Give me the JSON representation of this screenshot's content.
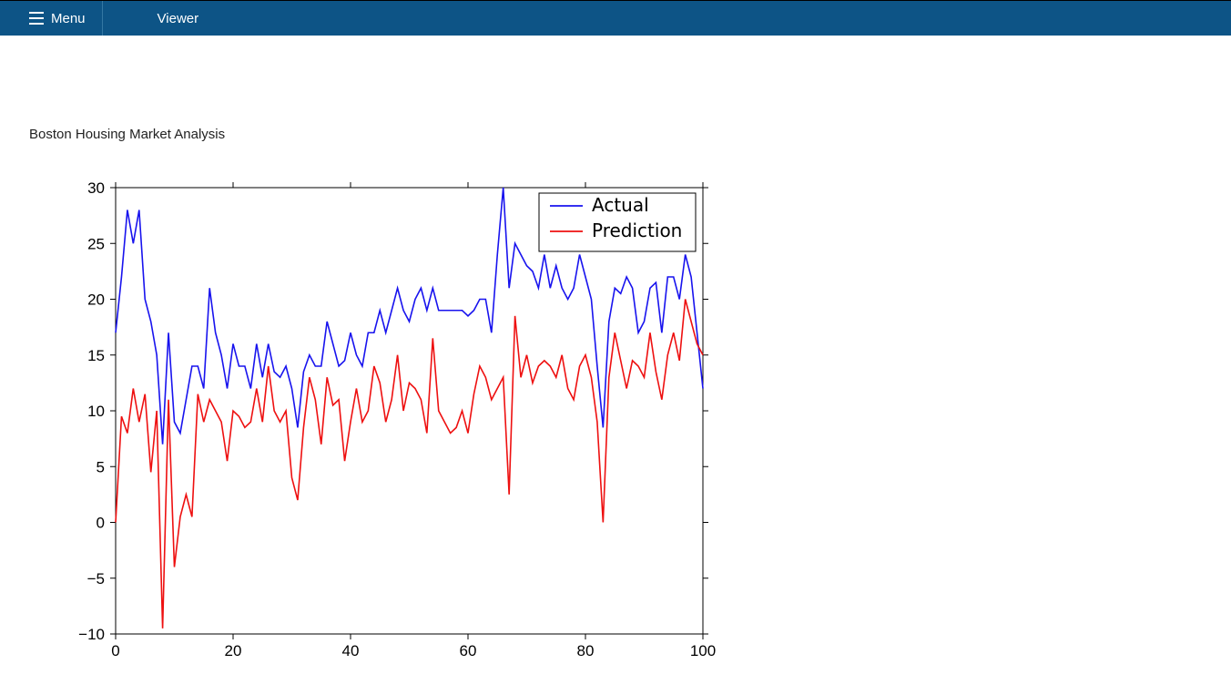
{
  "header": {
    "menu_label": "Menu",
    "viewer_label": "Viewer"
  },
  "page": {
    "title": "Boston Housing Market Analysis"
  },
  "chart_data": {
    "type": "line",
    "title": "",
    "xlabel": "",
    "ylabel": "",
    "xlim": [
      0,
      100
    ],
    "ylim": [
      -10,
      30
    ],
    "x_ticks": [
      0,
      20,
      40,
      60,
      80,
      100
    ],
    "y_ticks": [
      -10,
      -5,
      0,
      5,
      10,
      15,
      20,
      25,
      30
    ],
    "legend": [
      "Actual",
      "Prediction"
    ],
    "legend_loc": "upper-right-inset",
    "x": [
      0,
      1,
      2,
      3,
      4,
      5,
      6,
      7,
      8,
      9,
      10,
      11,
      12,
      13,
      14,
      15,
      16,
      17,
      18,
      19,
      20,
      21,
      22,
      23,
      24,
      25,
      26,
      27,
      28,
      29,
      30,
      31,
      32,
      33,
      34,
      35,
      36,
      37,
      38,
      39,
      40,
      41,
      42,
      43,
      44,
      45,
      46,
      47,
      48,
      49,
      50,
      51,
      52,
      53,
      54,
      55,
      56,
      57,
      58,
      59,
      60,
      61,
      62,
      63,
      64,
      65,
      66,
      67,
      68,
      69,
      70,
      71,
      72,
      73,
      74,
      75,
      76,
      77,
      78,
      79,
      80,
      81,
      82,
      83,
      84,
      85,
      86,
      87,
      88,
      89,
      90,
      91,
      92,
      93,
      94,
      95,
      96,
      97,
      98,
      99,
      100
    ],
    "series": [
      {
        "name": "Actual",
        "color": "#1813ee",
        "values": [
          17,
          22,
          28,
          25,
          28,
          20,
          18,
          15,
          7,
          17,
          9,
          8,
          11,
          14,
          14,
          12,
          21,
          17,
          15,
          12,
          16,
          14,
          14,
          12,
          16,
          13,
          16,
          13.5,
          13,
          14,
          12,
          8.5,
          13.5,
          15,
          14,
          14,
          18,
          16,
          14,
          14.5,
          17,
          15,
          14,
          17,
          17,
          19,
          17,
          19,
          21,
          19,
          18,
          20,
          21,
          19,
          21,
          19,
          19,
          19,
          19,
          19,
          18.5,
          19,
          20,
          20,
          17,
          24,
          30,
          21,
          25,
          24,
          23,
          22.5,
          21,
          24,
          21,
          23,
          21,
          20,
          21,
          24,
          22,
          20,
          14,
          8.5,
          18,
          21,
          20.5,
          22,
          21,
          17,
          18,
          21,
          21.5,
          17,
          22,
          22,
          20,
          24,
          22,
          17,
          12
        ]
      },
      {
        "name": "Prediction",
        "color": "#ee1010",
        "values": [
          0,
          9.5,
          8,
          12,
          9,
          11.5,
          4.5,
          10,
          -9.5,
          11,
          -4,
          0.5,
          2.5,
          0.5,
          11.5,
          9,
          11,
          10,
          9,
          5.5,
          10,
          9.5,
          8.5,
          9,
          12,
          9,
          14,
          10,
          9,
          10,
          4,
          2,
          8.5,
          13,
          11,
          7,
          13,
          10.5,
          11,
          5.5,
          9,
          12,
          9,
          10,
          14,
          12.5,
          9,
          11,
          15,
          10,
          12.5,
          12,
          11,
          8,
          16.5,
          10,
          9,
          8,
          8.5,
          10,
          8,
          11.5,
          14,
          13,
          11,
          12,
          13,
          2.5,
          18.5,
          13,
          15,
          12.5,
          14,
          14.5,
          14,
          13,
          15,
          12,
          11,
          14,
          15,
          13,
          9,
          0,
          13,
          17,
          14.5,
          12,
          14.5,
          14,
          13,
          17,
          13.5,
          11,
          15,
          17,
          14.5,
          20,
          18,
          16,
          15
        ]
      }
    ]
  }
}
